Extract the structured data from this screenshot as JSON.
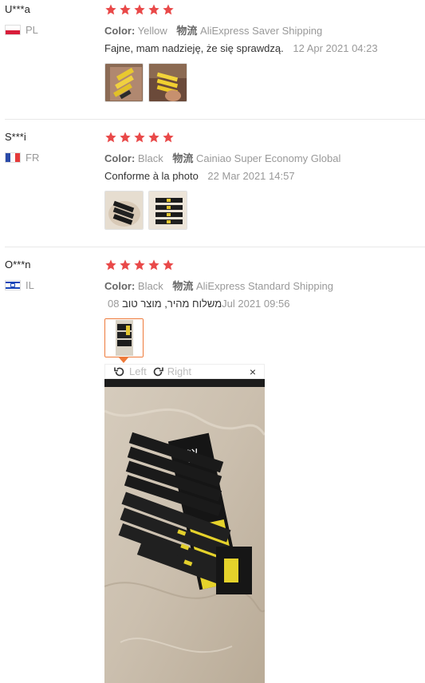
{
  "reviews": [
    {
      "user": "U***a",
      "country": "PL",
      "color_label": "Color:",
      "color_value": "Yellow",
      "shipping_label": "物流",
      "shipping_value": "AliExpress Saver Shipping",
      "text": "Fajne, mam nadzieję, że się sprawdzą.",
      "date": "12 Apr 2021 04:23",
      "rating": 5
    },
    {
      "user": "S***i",
      "country": "FR",
      "color_label": "Color:",
      "color_value": "Black",
      "shipping_label": "物流",
      "shipping_value": "Cainiao Super Economy Global",
      "text": "Conforme à la photo",
      "date": "22 Mar 2021 14:57",
      "rating": 5
    },
    {
      "user": "O***n",
      "country": "IL",
      "color_label": "Color:",
      "color_value": "Black",
      "shipping_label": "物流",
      "shipping_value": "AliExpress Standard Shipping",
      "text": "משלוח מהיר, מוצר טוב",
      "date_prefix": "08",
      "date": "Jul 2021 09:56",
      "rating": 5
    }
  ],
  "viewer": {
    "rotate_left": "Left",
    "rotate_right": "Right",
    "close": "×"
  },
  "colors": {
    "star": "#e94949",
    "accent": "#ee7a3a",
    "muted": "#999999"
  }
}
